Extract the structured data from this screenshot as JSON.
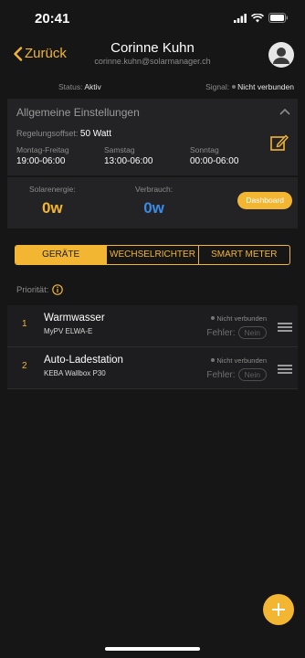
{
  "statusbar": {
    "time": "20:41"
  },
  "header": {
    "back_label": "Zurück",
    "name": "Corinne Kuhn",
    "email": "corinne.kuhn@solarmanager.ch"
  },
  "status": {
    "status_label": "Status:",
    "status_value": "Aktiv",
    "signal_label": "Signal:",
    "signal_value": "Nicht verbunden"
  },
  "settings": {
    "title": "Allgemeine Einstellungen",
    "offset_label": "Regelungsoffset:",
    "offset_value": "50 Watt",
    "schedule": [
      {
        "label": "Montag-Freitag",
        "value": "19:00-06:00"
      },
      {
        "label": "Samstag",
        "value": "13:00-06:00"
      },
      {
        "label": "Sonntag",
        "value": "00:00-06:00"
      }
    ]
  },
  "energy": {
    "solar_label": "Solarenergie:",
    "solar_value": "0w",
    "consumption_label": "Verbrauch:",
    "consumption_value": "0w",
    "dashboard_label": "Dashboard"
  },
  "tabs": [
    "GERÄTE",
    "WECHSELRICHTER",
    "SMART METER"
  ],
  "priority_label": "Priorität:",
  "devices": [
    {
      "index": "1",
      "name": "Warmwasser",
      "model": "MyPV ELWA-E",
      "status": "Nicht verbunden",
      "error_label": "Fehler:",
      "error_value": "Nein"
    },
    {
      "index": "2",
      "name": "Auto-Ladestation",
      "model": "KEBA Wallbox P30",
      "status": "Nicht verbunden",
      "error_label": "Fehler:",
      "error_value": "Nein"
    }
  ],
  "colors": {
    "accent": "#f2b632",
    "background": "#161617",
    "card": "#232325",
    "consumption": "#3b8ae6",
    "solar": "#f2b632"
  },
  "icons": [
    "back-chevron-icon",
    "avatar-icon",
    "chevron-up-icon",
    "edit-icon",
    "info-icon",
    "drag-handle-icon",
    "plus-icon"
  ]
}
